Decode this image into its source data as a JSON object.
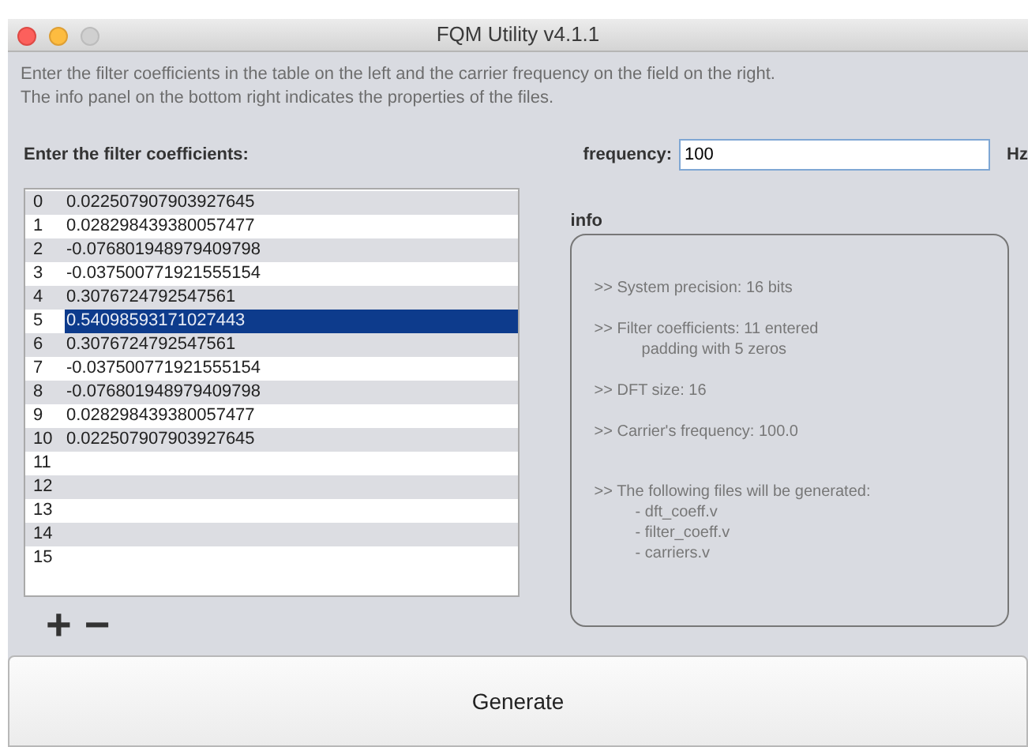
{
  "window": {
    "title": "FQM Utility v4.1.1"
  },
  "instructions": [
    "Enter the filter coefficients in the table on the left and the carrier frequency on the field on the right.",
    "The info panel on the bottom right indicates the properties of the files."
  ],
  "coefficients": {
    "heading": "Enter the filter coefficients:",
    "rows": [
      {
        "index": "0",
        "value": "0.022507907903927645",
        "selected": false
      },
      {
        "index": "1",
        "value": "0.028298439380057477",
        "selected": false
      },
      {
        "index": "2",
        "value": "-0.076801948979409798",
        "selected": false
      },
      {
        "index": "3",
        "value": "-0.037500771921555154",
        "selected": false
      },
      {
        "index": "4",
        "value": "0.3076724792547561",
        "selected": false
      },
      {
        "index": "5",
        "value": "0.54098593171027443",
        "selected": true
      },
      {
        "index": "6",
        "value": "0.3076724792547561",
        "selected": false
      },
      {
        "index": "7",
        "value": "-0.037500771921555154",
        "selected": false
      },
      {
        "index": "8",
        "value": "-0.076801948979409798",
        "selected": false
      },
      {
        "index": "9",
        "value": "0.028298439380057477",
        "selected": false
      },
      {
        "index": "10",
        "value": "0.022507907903927645",
        "selected": false
      },
      {
        "index": "11",
        "selected": false
      },
      {
        "index": "12",
        "selected": false
      },
      {
        "index": "13",
        "selected": false
      },
      {
        "index": "14",
        "selected": false
      },
      {
        "index": "15",
        "selected": false
      }
    ],
    "add_button": "+",
    "remove_button": "−"
  },
  "frequency": {
    "label": "frequency:",
    "value": "100",
    "unit": "Hz"
  },
  "info": {
    "title": "info",
    "entries": [
      {
        "lines": [
          ">> System precision: 16 bits"
        ]
      },
      {
        "lines": [
          ">> Filter coefficients: 11 entered",
          "padding with 5 zeros"
        ]
      },
      {
        "lines": [
          ">> DFT size: 16"
        ]
      },
      {
        "lines": [
          ">> Carrier's frequency: 100.0"
        ]
      },
      {
        "lines": [
          ">> The following files will be generated:",
          "- dft_coeff.v",
          "- filter_coeff.v",
          "- carriers.v"
        ]
      }
    ]
  },
  "generate_button": "Generate"
}
